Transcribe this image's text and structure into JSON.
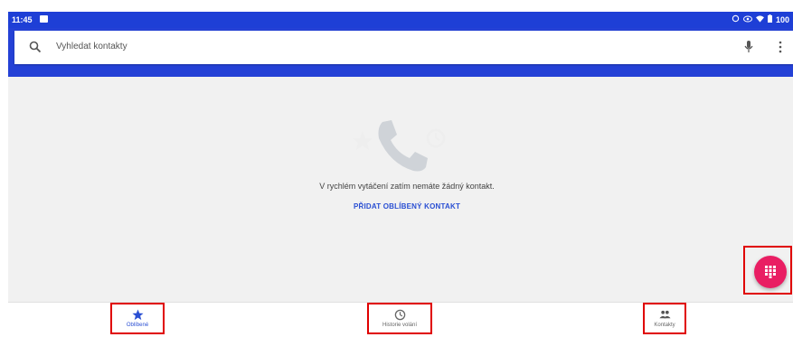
{
  "status_bar": {
    "time": "11:45",
    "battery": "100",
    "icons": [
      "image-icon",
      "alarm-icon",
      "eye-icon",
      "wifi-icon",
      "battery-icon"
    ]
  },
  "search": {
    "placeholder": "Vyhledat kontakty",
    "icons": [
      "search-icon",
      "mic-icon",
      "more-vert-icon"
    ]
  },
  "empty_state": {
    "message": "V rychlém vytáčení zatím nemáte žádný kontakt.",
    "action_label": "PŘIDAT OBLÍBENÝ KONTAKT",
    "illustration_icons": [
      "star-icon",
      "phone-icon",
      "clock-icon"
    ]
  },
  "fab": {
    "icon": "dialpad-icon",
    "color": "#e91e63"
  },
  "bottom_nav": {
    "items": [
      {
        "label": "Oblíbené",
        "icon": "star-icon",
        "selected": true
      },
      {
        "label": "Historie volání",
        "icon": "clock-icon",
        "selected": false
      },
      {
        "label": "Kontakty",
        "icon": "people-icon",
        "selected": false
      }
    ]
  },
  "colors": {
    "primary": "#2441d6",
    "accent": "#e91e63",
    "highlight_box": "#e00000",
    "background": "#f1f1f1"
  }
}
